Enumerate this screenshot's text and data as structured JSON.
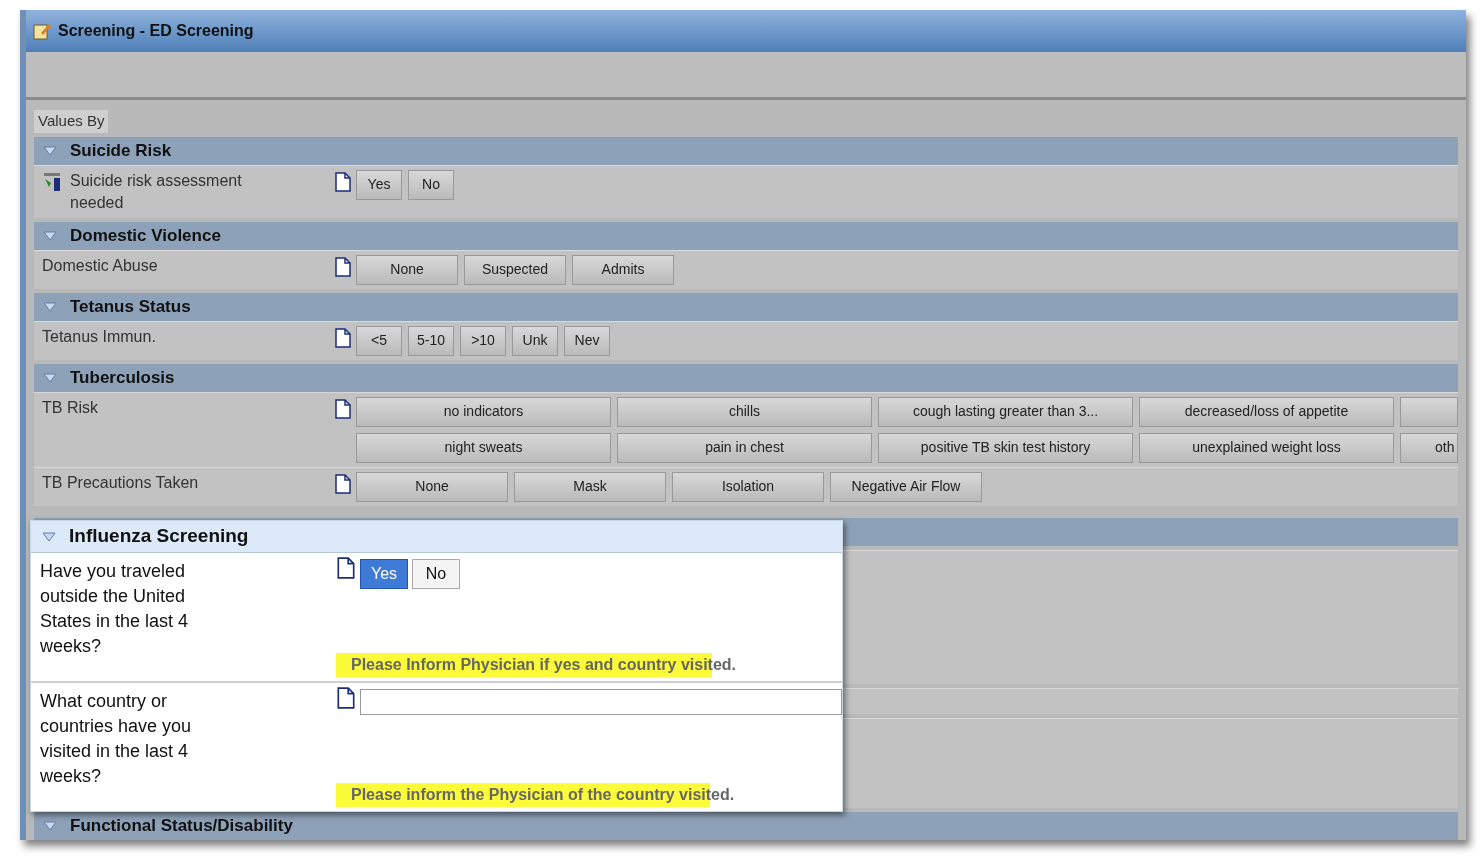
{
  "window": {
    "title": "Screening - ED Screening"
  },
  "values_by": "Values By",
  "sections": [
    {
      "title": "Suicide Risk",
      "expanded": true,
      "rows": [
        {
          "kind": "short",
          "label": "Suicide risk assessment needed",
          "flagged": true,
          "options": [
            {
              "label": "Yes",
              "selected": false
            },
            {
              "label": "No",
              "selected": false
            }
          ]
        }
      ]
    },
    {
      "title": "Domestic Violence",
      "expanded": true,
      "rows": [
        {
          "kind": "medium",
          "label": "Domestic Abuse",
          "flagged": false,
          "options": [
            {
              "label": "None",
              "selected": false
            },
            {
              "label": "Suspected",
              "selected": false
            },
            {
              "label": "Admits",
              "selected": false
            }
          ]
        }
      ]
    },
    {
      "title": "Tetanus Status",
      "expanded": true,
      "rows": [
        {
          "kind": "short",
          "label": "Tetanus Immun.",
          "flagged": false,
          "options": [
            {
              "label": "<5",
              "selected": false
            },
            {
              "label": "5-10",
              "selected": false
            },
            {
              "label": ">10",
              "selected": false
            },
            {
              "label": "Unk",
              "selected": false
            },
            {
              "label": "Nev",
              "selected": false
            }
          ]
        }
      ]
    },
    {
      "title": "Tuberculosis",
      "expanded": true,
      "rows": [
        {
          "kind": "grid",
          "label": "TB Risk",
          "flagged": false,
          "options": [
            {
              "label": "no indicators",
              "selected": false
            },
            {
              "label": "chills",
              "selected": false
            },
            {
              "label": "cough lasting greater than 3...",
              "selected": false
            },
            {
              "label": "decreased/loss of appetite",
              "selected": false
            },
            {
              "selected": false
            },
            {
              "label": "night sweats",
              "selected": false
            },
            {
              "label": "pain in chest",
              "selected": false
            },
            {
              "label": "positive TB skin test history",
              "selected": false
            },
            {
              "label": "unexplained weight loss",
              "selected": false
            },
            {
              "label": "oth",
              "selected": false
            }
          ]
        },
        {
          "kind": "wide",
          "label": "TB Precautions Taken",
          "flagged": false,
          "options": [
            {
              "label": "None",
              "selected": false
            },
            {
              "label": "Mask",
              "selected": false
            },
            {
              "label": "Isolation",
              "selected": false
            },
            {
              "label": "Negative Air Flow",
              "selected": false
            }
          ]
        }
      ]
    }
  ],
  "popup": {
    "title": "Influenza Screening",
    "expanded": true,
    "rows": [
      {
        "kind": "choice",
        "label": "Have you traveled outside the United States in the last 4 weeks?",
        "options": [
          {
            "label": "Yes",
            "selected": true
          },
          {
            "label": "No",
            "selected": false
          }
        ],
        "note": "Please Inform Physician if yes and country visited.",
        "highlighted": true
      },
      {
        "kind": "text",
        "label": "What country or countries have you visited in the last 4 weeks?",
        "note": "Please inform the Physician of the country visited.",
        "highlighted": true
      }
    ]
  },
  "footer_section": {
    "title": "Functional Status/Disability",
    "expanded": true
  }
}
